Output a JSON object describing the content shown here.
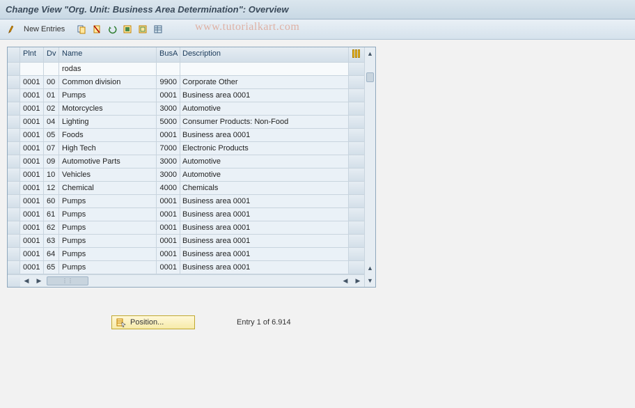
{
  "title": "Change View \"Org. Unit: Business Area Determination\": Overview",
  "toolbar": {
    "new_entries": "New Entries"
  },
  "watermark": "www.tutorialkart.com",
  "grid": {
    "headers": {
      "plnt": "Plnt",
      "dv": "Dv",
      "name": "Name",
      "busa": "BusA",
      "desc": "Description"
    },
    "filter": {
      "name": "rodas"
    },
    "rows": [
      {
        "plnt": "0001",
        "dv": "00",
        "name": "Common division",
        "busa": "9900",
        "desc": "Corporate Other",
        "pad": false
      },
      {
        "plnt": "0001",
        "dv": "01",
        "name": "Pumps",
        "busa": "0001",
        "desc": "Business area 0001",
        "pad": true
      },
      {
        "plnt": "0001",
        "dv": "02",
        "name": "Motorcycles",
        "busa": "3000",
        "desc": "Automotive",
        "pad": false
      },
      {
        "plnt": "0001",
        "dv": "04",
        "name": "Lighting",
        "busa": "5000",
        "desc": "Consumer Products: Non-Food",
        "pad": false
      },
      {
        "plnt": "0001",
        "dv": "05",
        "name": "Foods",
        "busa": "0001",
        "desc": "Business area 0001",
        "pad": true
      },
      {
        "plnt": "0001",
        "dv": "07",
        "name": "High Tech",
        "busa": "7000",
        "desc": "Electronic Products",
        "pad": false
      },
      {
        "plnt": "0001",
        "dv": "09",
        "name": "Automotive Parts",
        "busa": "3000",
        "desc": "Automotive",
        "pad": false
      },
      {
        "plnt": "0001",
        "dv": "10",
        "name": "Vehicles",
        "busa": "3000",
        "desc": "Automotive",
        "pad": false
      },
      {
        "plnt": "0001",
        "dv": "12",
        "name": "Chemical",
        "busa": "4000",
        "desc": "Chemicals",
        "pad": false
      },
      {
        "plnt": "0001",
        "dv": "60",
        "name": "Pumps",
        "busa": "0001",
        "desc": "Business area 0001",
        "pad": true
      },
      {
        "plnt": "0001",
        "dv": "61",
        "name": "Pumps",
        "busa": "0001",
        "desc": "Business area 0001",
        "pad": true
      },
      {
        "plnt": "0001",
        "dv": "62",
        "name": "Pumps",
        "busa": "0001",
        "desc": "Business area 0001",
        "pad": true
      },
      {
        "plnt": "0001",
        "dv": "63",
        "name": "Pumps",
        "busa": "0001",
        "desc": "Business area 0001",
        "pad": true
      },
      {
        "plnt": "0001",
        "dv": "64",
        "name": "Pumps",
        "busa": "0001",
        "desc": "Business area 0001",
        "pad": true
      },
      {
        "plnt": "0001",
        "dv": "65",
        "name": "Pumps",
        "busa": "0001",
        "desc": "Business area 0001",
        "pad": true
      }
    ]
  },
  "footer": {
    "position": "Position...",
    "entry": "Entry 1 of 6.914"
  }
}
